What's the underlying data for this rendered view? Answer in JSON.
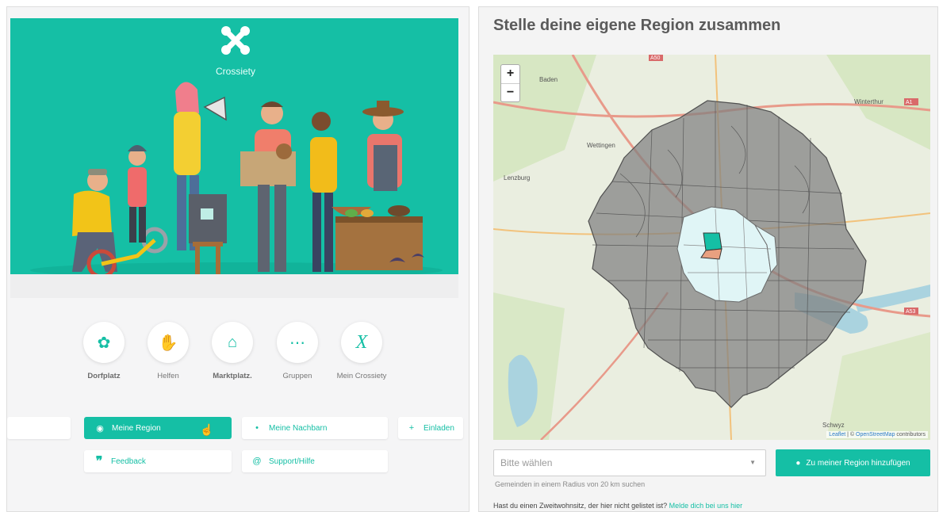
{
  "left": {
    "brand": "Crossiety",
    "tiles": [
      {
        "label": "Dorfplatz",
        "icon": "dorfplatz-flower-icon",
        "bold": true
      },
      {
        "label": "Helfen",
        "icon": "helping-hand-icon",
        "bold": false
      },
      {
        "label": "Marktplatz.",
        "icon": "basket-icon",
        "bold": true
      },
      {
        "label": "Gruppen",
        "icon": "groups-icon",
        "bold": false
      },
      {
        "label": "Mein Crossiety",
        "icon": "crossiety-x-icon",
        "bold": false
      }
    ],
    "buttons": {
      "meine_region": "Meine Region",
      "meine_nachbarn": "Meine Nachbarn",
      "einladen": "Einladen",
      "feedback": "Feedback",
      "support": "Support/Hilfe"
    }
  },
  "right": {
    "title": "Stelle deine eigene Region zusammen",
    "map": {
      "zoom_in": "+",
      "zoom_out": "−",
      "attrib_leaflet": "Leaflet",
      "attrib_sep": " | © ",
      "attrib_osm": "OpenStreetMap",
      "attrib_tail": " contributors",
      "places": [
        "Winterthur",
        "Baden",
        "Wettingen",
        "Lenzburg",
        "Schwyz"
      ],
      "roads": [
        "A50",
        "A1",
        "A53"
      ]
    },
    "select_placeholder": "Bitte wählen",
    "add_button": "Zu meiner Region hinzufügen",
    "help_text": "Gemeinden in einem Radius von 20 km suchen",
    "footer_text": "Hast du einen Zweitwohnsitz, der hier nicht gelistet ist? ",
    "footer_link": "Melde dich bei uns hier"
  },
  "colors": {
    "accent": "#15bfa5",
    "panel_bg": "#f5f5f6",
    "region_fill": "#7d7d7d",
    "selected_fill": "#d9f3f4"
  }
}
